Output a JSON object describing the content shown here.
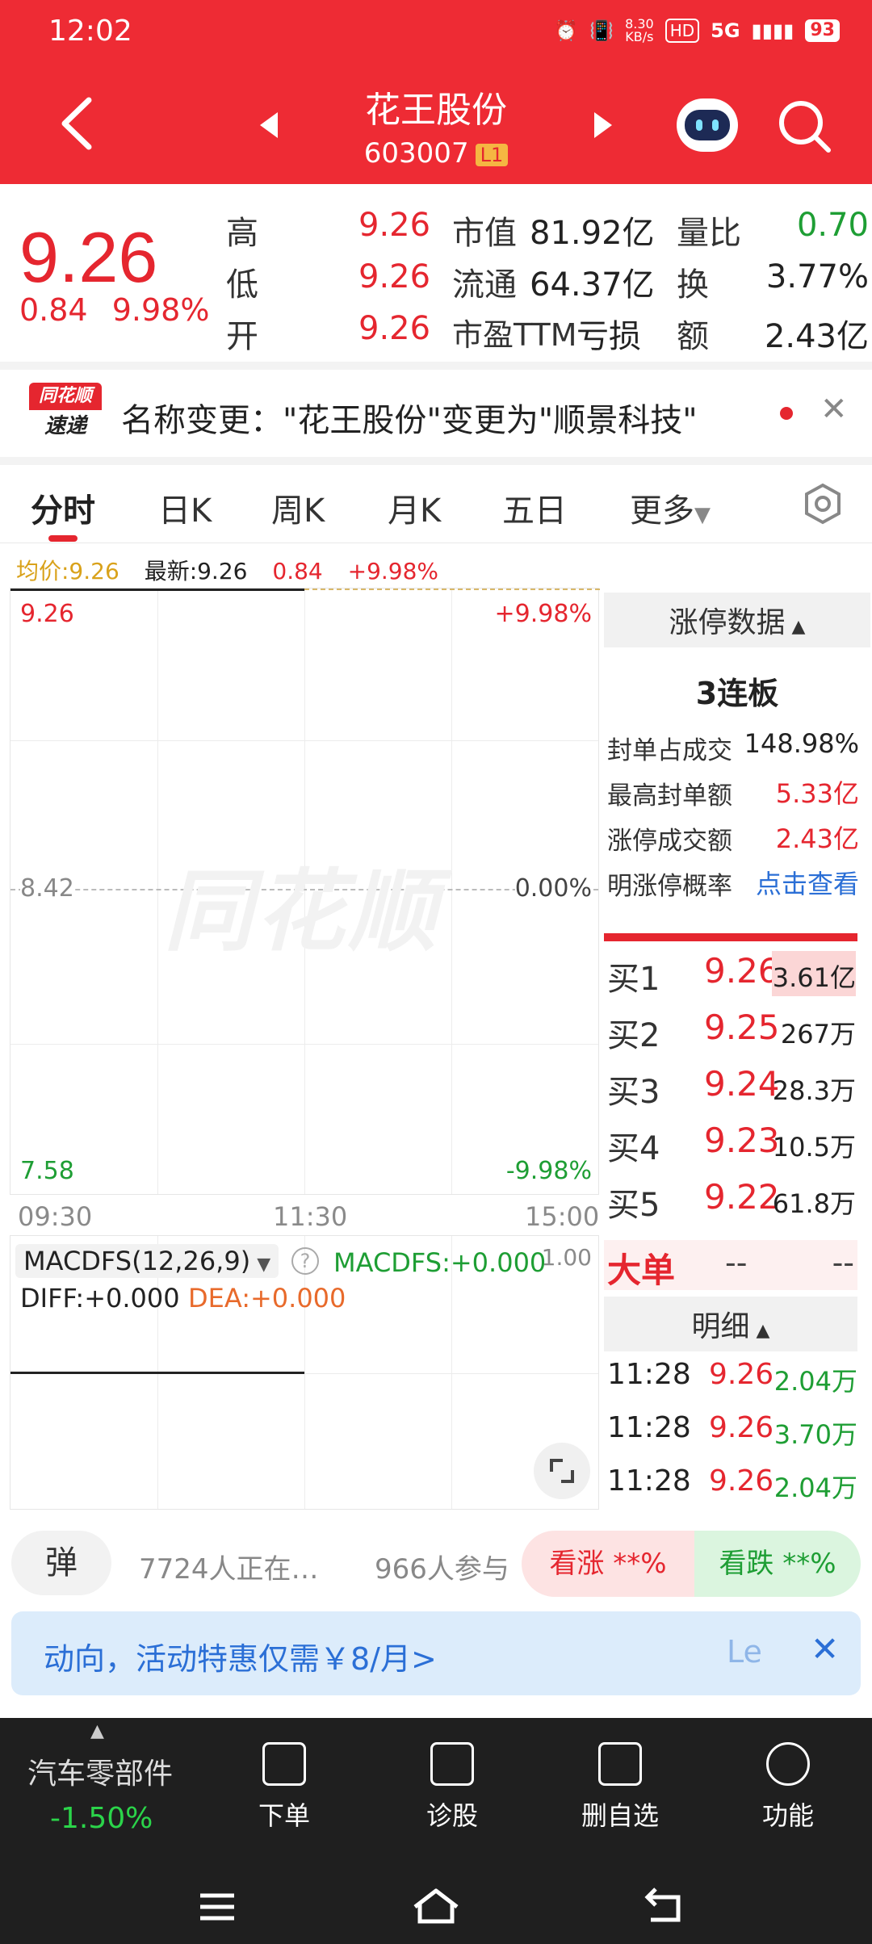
{
  "status_bar": {
    "time": "12:02",
    "net_speed": "8.30\nKB/s",
    "hd": "HD",
    "signal": "5G",
    "battery": "93"
  },
  "header": {
    "name": "花王股份",
    "code": "603007",
    "level": "L1"
  },
  "quote": {
    "price": "9.26",
    "change": "0.84",
    "pct": "9.98%",
    "high_label": "高",
    "high": "9.26",
    "low_label": "低",
    "low": "9.26",
    "open_label": "开",
    "open": "9.26",
    "mcap_label": "市值",
    "mcap": "81.92亿",
    "float_label": "流通",
    "float": "64.37亿",
    "pe_label": "市盈TTM",
    "pe": "亏损",
    "vr_label": "量比",
    "vr": "0.70",
    "turn_label": "换",
    "turn": "3.77%",
    "amt_label": "额",
    "amt": "2.43亿"
  },
  "news": {
    "brand_top": "同花顺",
    "brand_bottom": "速递",
    "text": "名称变更：\"花王股份\"变更为\"顺景科技\""
  },
  "tabs": [
    "分时",
    "日K",
    "周K",
    "月K",
    "五日",
    "更多"
  ],
  "chart_info": {
    "avg": "均价:9.26",
    "latest": "最新:9.26",
    "chg": "0.84",
    "pct": "+9.98%"
  },
  "chart": {
    "y_top": "9.26",
    "y_mid": "8.42",
    "y_bot": "7.58",
    "pct_top": "+9.98%",
    "pct_mid": "0.00%",
    "pct_bot": "-9.98%",
    "t_start": "09:30",
    "t_mid": "11:30",
    "t_end": "15:00",
    "watermark": "同花顺"
  },
  "macd": {
    "name": "MACDFS(12,26,9)",
    "value": "MACDFS:+0.000",
    "diff": "DIFF:+0.000",
    "dea": "DEA:+0.000",
    "scale": "1.00"
  },
  "limit": {
    "title": "涨停数据",
    "streak": "3连板",
    "rows": [
      {
        "label": "封单占成交",
        "value": "148.98%"
      },
      {
        "label": "最高封单额",
        "value": "5.33亿"
      },
      {
        "label": "涨停成交额",
        "value": "2.43亿"
      },
      {
        "label": "明涨停概率",
        "value": "点击查看"
      }
    ]
  },
  "book": [
    {
      "label": "买1",
      "price": "9.26",
      "vol": "3.61亿"
    },
    {
      "label": "买2",
      "price": "9.25",
      "vol": "267万"
    },
    {
      "label": "买3",
      "price": "9.24",
      "vol": "28.3万"
    },
    {
      "label": "买4",
      "price": "9.23",
      "vol": "10.5万"
    },
    {
      "label": "买5",
      "price": "9.22",
      "vol": "61.8万"
    }
  ],
  "big_order": {
    "label": "大单",
    "v1": "--",
    "v2": "--"
  },
  "detail": {
    "title": "明细",
    "rows": [
      {
        "time": "11:28",
        "price": "9.26",
        "vol": "2.04万"
      },
      {
        "time": "11:28",
        "price": "9.26",
        "vol": "3.70万"
      },
      {
        "time": "11:28",
        "price": "9.26",
        "vol": "2.04万"
      }
    ]
  },
  "social": {
    "danmu": "弹",
    "watching": "7724人正在…",
    "participate": "966人参与",
    "up": "看涨 **%",
    "down": "看跌 **%"
  },
  "promo": {
    "text": "动向，活动特惠仅需￥8/月>",
    "more": "Le"
  },
  "bottom": {
    "sector": "汽车零部件",
    "sector_pct": "-1.50%",
    "items": [
      "下单",
      "诊股",
      "删自选",
      "功能"
    ]
  },
  "colors": {
    "brand_red": "#ee2b34",
    "up_red": "#e5262f",
    "down_green": "#1e9e34",
    "avg_yellow": "#d9a21b",
    "link_blue": "#2b6fd6"
  }
}
